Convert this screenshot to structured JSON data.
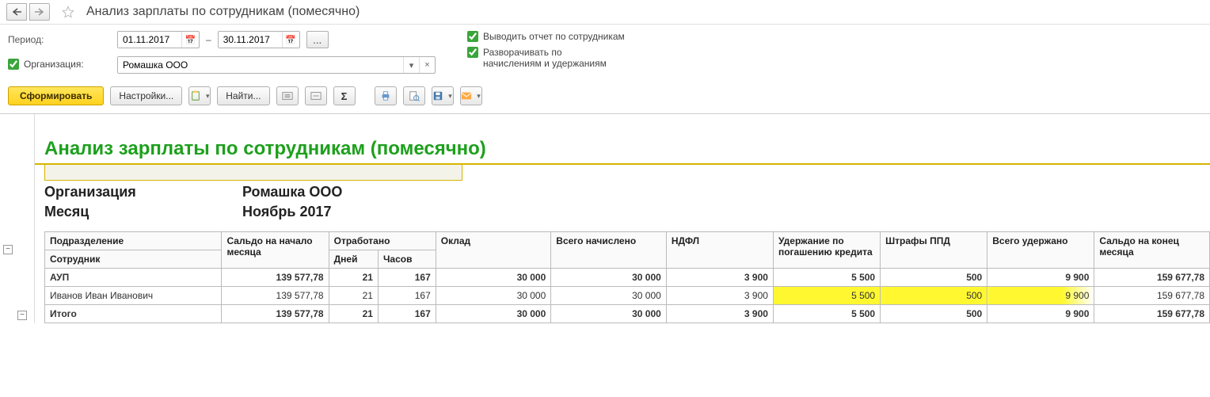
{
  "titlebar": {
    "title": "Анализ зарплаты по сотрудникам (помесячно)"
  },
  "filters": {
    "period_label": "Период:",
    "date_from": "01.11.2017",
    "date_to": "30.11.2017",
    "org_label": "Организация:",
    "org_value": "Ромашка ООО",
    "opt_by_employee": "Выводить отчет по сотрудникам",
    "opt_expand": "Разворачивать по начислениям и удержаниям"
  },
  "toolbar": {
    "generate": "Сформировать",
    "settings": "Настройки...",
    "find": "Найти..."
  },
  "report": {
    "title": "Анализ зарплаты по сотрудникам (помесячно)",
    "meta": {
      "org_label": "Организация",
      "org_value": "Ромашка ООО",
      "month_label": "Месяц",
      "month_value": "Ноябрь 2017"
    },
    "columns": {
      "dept": "Подразделение",
      "employee": "Сотрудник",
      "saldo_start": "Сальдо на начало месяца",
      "worked": "Отработано",
      "days": "Дней",
      "hours": "Часов",
      "salary": "Оклад",
      "total_accrued": "Всего начислено",
      "ndfl": "НДФЛ",
      "loan_ded": "Удержание по погашению кредита",
      "fines": "Штрафы ППД",
      "total_ded": "Всего удержано",
      "saldo_end": "Сальдо на конец месяца"
    },
    "rows": [
      {
        "type": "dept",
        "name": "АУП",
        "saldo_start": "139 577,78",
        "days": "21",
        "hours": "167",
        "salary": "30 000",
        "total_accrued": "30 000",
        "ndfl": "3 900",
        "loan_ded": "5 500",
        "fines": "500",
        "total_ded": "9 900",
        "saldo_end": "159 677,78"
      },
      {
        "type": "emp",
        "name": "Иванов Иван Иванович",
        "saldo_start": "139 577,78",
        "days": "21",
        "hours": "167",
        "salary": "30 000",
        "total_accrued": "30 000",
        "ndfl": "3 900",
        "loan_ded": "5 500",
        "fines": "500",
        "total_ded": "9 900",
        "saldo_end": "159 677,78"
      },
      {
        "type": "total",
        "name": "Итого",
        "saldo_start": "139 577,78",
        "days": "21",
        "hours": "167",
        "salary": "30 000",
        "total_accrued": "30 000",
        "ndfl": "3 900",
        "loan_ded": "5 500",
        "fines": "500",
        "total_ded": "9 900",
        "saldo_end": "159 677,78"
      }
    ]
  }
}
